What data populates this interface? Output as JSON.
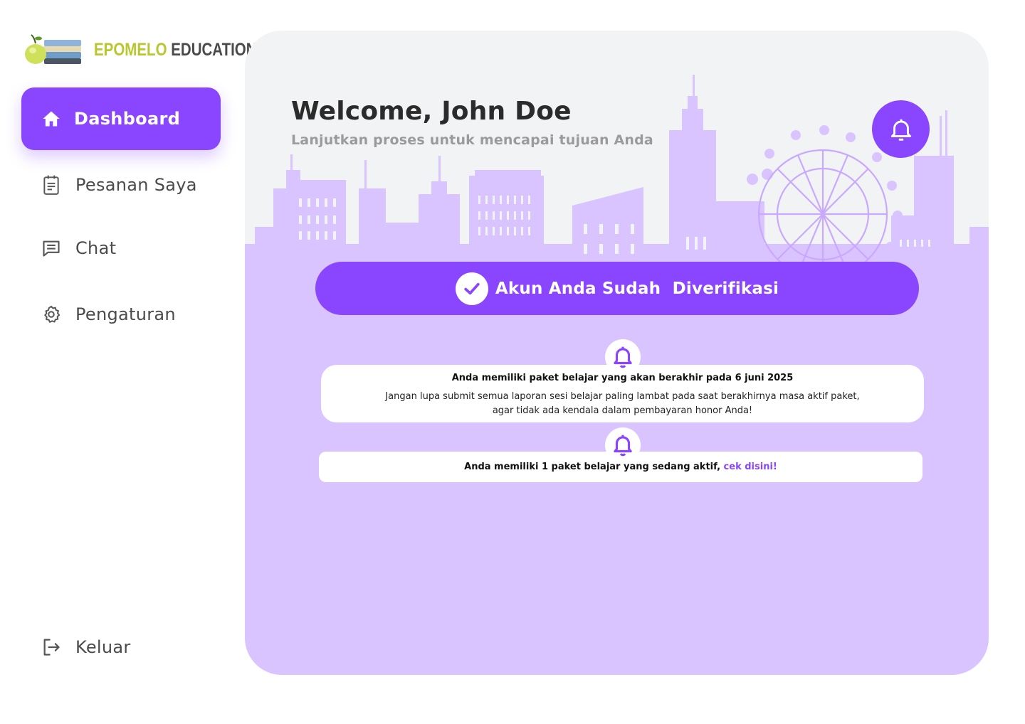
{
  "brand": {
    "name_part1": "EPOMELO",
    "name_part2": "EDUCATION"
  },
  "sidebar": {
    "items": [
      {
        "label": "Dashboard",
        "icon": "home-icon",
        "active": true
      },
      {
        "label": "Pesanan Saya",
        "icon": "clipboard-icon",
        "active": false
      },
      {
        "label": "Chat",
        "icon": "chat-icon",
        "active": false
      },
      {
        "label": "Pengaturan",
        "icon": "gear-icon",
        "active": false
      }
    ],
    "logout": {
      "label": "Keluar",
      "icon": "logout-icon"
    }
  },
  "header": {
    "title": "Welcome, John Doe",
    "subtitle": "Lanjutkan proses untuk mencapai tujuan Anda",
    "bell_icon": "bell-icon"
  },
  "verification": {
    "label": "Akun Anda Sudah  Diverifikasi",
    "icon": "check-circle-icon"
  },
  "notifications": [
    {
      "title": "Anda memiliki paket belajar yang akan berakhir pada 6 juni 2025",
      "body_line1": "Jangan lupa submit semua laporan sesi belajar paling lambat pada saat berakhirnya masa aktif paket,",
      "body_line2": "agar tidak ada kendala dalam pembayaran honor Anda!"
    },
    {
      "title": "Anda memiliki 1 paket belajar  yang sedang aktif,",
      "link": "cek disini!"
    }
  ],
  "colors": {
    "accent": "#8a45ff",
    "accent_light": "#dac4ff",
    "card_bg": "#f2f3f5",
    "brand_green": "#b9c72e"
  }
}
